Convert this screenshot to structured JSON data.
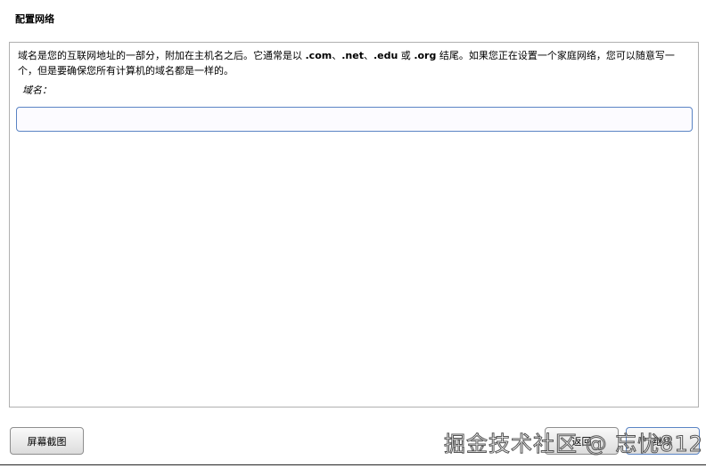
{
  "title": "配置网络",
  "description": {
    "part1": "域名是您的互联网地址的一部分，附加在主机名之后。它通常是以 ",
    "com": ".com",
    "sep1": "、",
    "net": ".net",
    "sep2": "、",
    "edu": ".edu",
    "or": " 或 ",
    "org": ".org",
    "part2": " 结尾。如果您正在设置一个家庭网络，您可以随意写一个，但是要确保您所有计算机的域名都是一样的。"
  },
  "field": {
    "label": "域名：",
    "value": ""
  },
  "buttons": {
    "screenshot": "屏幕截图",
    "back": "返回",
    "continue": "继续"
  },
  "watermark": "掘金技术社区 @ 忘忧812"
}
